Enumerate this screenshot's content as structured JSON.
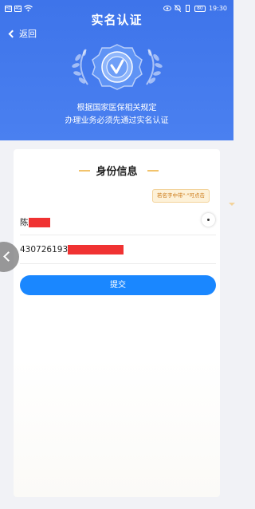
{
  "status_bar": {
    "left_icons": [
      "sim-icon",
      "sim2-icon",
      "wifi-icon"
    ],
    "right_icons": [
      "eye-icon",
      "mute-icon",
      "vibrate-icon"
    ],
    "battery": "80",
    "time": "19:30"
  },
  "header": {
    "title": "实名认证",
    "back_label": "返回",
    "badge_icon": "verified-check-icon",
    "subtitle_line1": "根据国家医保相关规定",
    "subtitle_line2": "办理业务必须先通过实名认证",
    "accent_color": "#3e74ea"
  },
  "form": {
    "section_title": "身份信息",
    "tip": "若名字中带\"·\"可点击",
    "name_value": "陈",
    "id_value": "430726193",
    "submit_label": "提交",
    "submit_color": "#1a87ff",
    "redaction_color": "#f03232"
  }
}
